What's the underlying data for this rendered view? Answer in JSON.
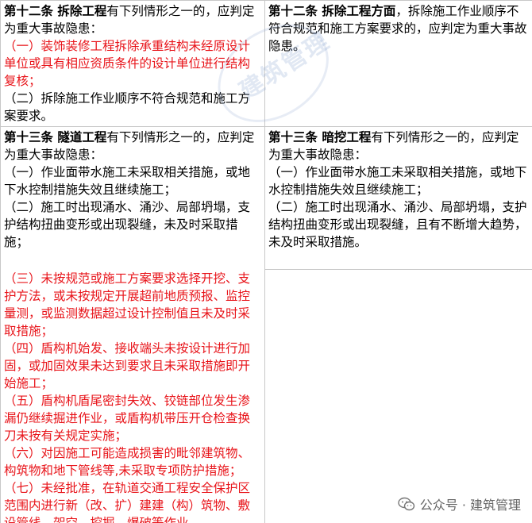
{
  "rows": [
    {
      "left": {
        "head_bold": "第十二条  拆除工程",
        "head_tail": "有下列情形之一的，应判定为重大事故隐患：",
        "items": [
          {
            "text": "（一）装饰装修工程拆除承重结构未经原设计单位或具有相应资质条件的设计单位进行结构复核；",
            "red": true
          },
          {
            "text": "（二）拆除施工作业顺序不符合规范和施工方案要求。",
            "red": false
          }
        ]
      },
      "right": {
        "head_bold": "第十二条  拆除工程方面",
        "head_tail": "，拆除施工作业顺序不符合规范和施工方案要求的，应判定为重大事故隐患。",
        "items": []
      }
    },
    {
      "left": {
        "head_bold": "第十三条  隧道工程",
        "head_tail": "有下列情形之一的，应判定为重大事故隐患：",
        "items": [
          {
            "text": "（一）作业面带水施工未采取相关措施，或地下水控制措施失效且继续施工；",
            "red": false
          },
          {
            "text": "（二）施工时出现涌水、涌沙、局部坍塌，支护结构扭曲变形或出现裂缝，未及时采取措施；",
            "red": false
          },
          {
            "text": "",
            "red": false
          },
          {
            "text": "（三）未按规范或施工方案要求选择开挖、支护方法，或未按规定开展超前地质预报、监控量测，或监测数据超过设计控制值且未及时采取措施；",
            "red": true
          },
          {
            "text": "（四）盾构机始发、接收端头未按设计进行加固，或加固效果未达到要求且未采取措施即开始施工；",
            "red": true
          },
          {
            "text": "（五）盾构机盾尾密封失效、铰链部位发生渗漏仍继续掘进作业，或盾构机带压开仓检查换刀未按有关规定实施；",
            "red": true
          },
          {
            "text": "（六）对因施工可能造成损害的毗邻建筑物、构筑物和地下管线等,未采取专项防护措施；",
            "red": true
          },
          {
            "text": "（七）未经批准，在轨道交通工程安全保护区范围内进行新（改、扩）建建（构）筑物、敷设管线、架空、挖掘、爆破等作业。",
            "red": true
          }
        ]
      },
      "right": {
        "head_bold": "第十三条  暗挖工程",
        "head_tail": "有下列情形之一的，应判定为重大事故隐患：",
        "items": [
          {
            "text": "（一）作业面带水施工未采取相关措施，或地下水控制措施失效且继续施工；",
            "red": false
          },
          {
            "text": "（二）施工时出现涌水、涌沙、局部坍塌，支护结构扭曲变形或出现裂缝，且有不断增大趋势，未及时采取措施。",
            "red": false
          }
        ]
      }
    }
  ],
  "watermark": "建筑管理",
  "footer": "公众号 · 建筑管理",
  "colors": {
    "red": "#e8141a",
    "border": "#c8c8c8"
  }
}
